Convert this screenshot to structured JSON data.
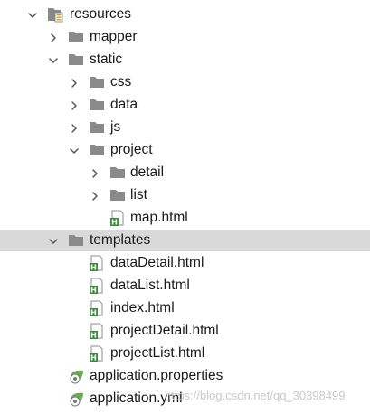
{
  "tree": {
    "rows": [
      {
        "label": "resources",
        "type": "resources-folder",
        "expanded": true,
        "has_chevron": true,
        "depth": 0
      },
      {
        "label": "mapper",
        "type": "folder",
        "expanded": false,
        "has_chevron": true,
        "depth": 1
      },
      {
        "label": "static",
        "type": "folder",
        "expanded": true,
        "has_chevron": true,
        "depth": 1
      },
      {
        "label": "css",
        "type": "folder",
        "expanded": false,
        "has_chevron": true,
        "depth": 2
      },
      {
        "label": "data",
        "type": "folder",
        "expanded": false,
        "has_chevron": true,
        "depth": 2
      },
      {
        "label": "js",
        "type": "folder",
        "expanded": false,
        "has_chevron": true,
        "depth": 2
      },
      {
        "label": "project",
        "type": "folder",
        "expanded": true,
        "has_chevron": true,
        "depth": 2
      },
      {
        "label": "detail",
        "type": "folder",
        "expanded": false,
        "has_chevron": true,
        "depth": 3
      },
      {
        "label": "list",
        "type": "folder",
        "expanded": false,
        "has_chevron": true,
        "depth": 3
      },
      {
        "label": "map.html",
        "type": "html-file",
        "expanded": false,
        "has_chevron": false,
        "depth": 3
      },
      {
        "label": "templates",
        "type": "folder",
        "expanded": true,
        "has_chevron": true,
        "depth": 1,
        "selected": true
      },
      {
        "label": "dataDetail.html",
        "type": "html-file",
        "expanded": false,
        "has_chevron": false,
        "depth": 2
      },
      {
        "label": "dataList.html",
        "type": "html-file",
        "expanded": false,
        "has_chevron": false,
        "depth": 2
      },
      {
        "label": "index.html",
        "type": "html-file",
        "expanded": false,
        "has_chevron": false,
        "depth": 2
      },
      {
        "label": "projectDetail.html",
        "type": "html-file",
        "expanded": false,
        "has_chevron": false,
        "depth": 2
      },
      {
        "label": "projectList.html",
        "type": "html-file",
        "expanded": false,
        "has_chevron": false,
        "depth": 2
      },
      {
        "label": "application.properties",
        "type": "spring-config-file",
        "expanded": false,
        "has_chevron": false,
        "depth": 1
      },
      {
        "label": "application.yml",
        "type": "spring-config-file",
        "expanded": false,
        "has_chevron": false,
        "depth": 1
      }
    ]
  },
  "watermark": {
    "text": "https://blog.csdn.net/qq_30398499"
  },
  "colors": {
    "folder": "#8a8a8a",
    "selection": "#d9d9d9",
    "html_badge": "#3c8b3c",
    "spring": "#6aab52",
    "chevron": "#555555"
  }
}
